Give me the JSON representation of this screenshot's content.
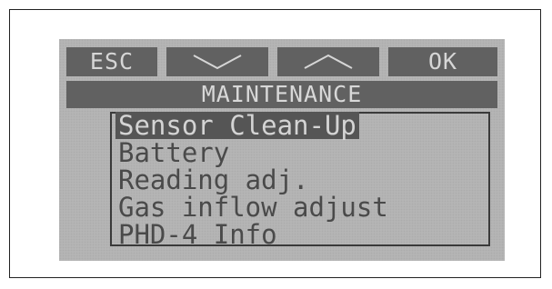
{
  "softkeys": {
    "esc": "ESC",
    "down_icon": "chevron-down-icon",
    "up_icon": "chevron-up-icon",
    "ok": "OK"
  },
  "screen": {
    "title": "MAINTENANCE"
  },
  "menu": {
    "selected_index": 0,
    "items": [
      {
        "label": "Sensor Clean-Up"
      },
      {
        "label": "Battery"
      },
      {
        "label": "Reading adj."
      },
      {
        "label": "Gas inflow adjust"
      },
      {
        "label": "PHD-4 Info"
      }
    ]
  },
  "colors": {
    "lcd_background": "#b7b7b7",
    "bar_dark": "#616161",
    "text_dark": "#4a4a4a"
  }
}
